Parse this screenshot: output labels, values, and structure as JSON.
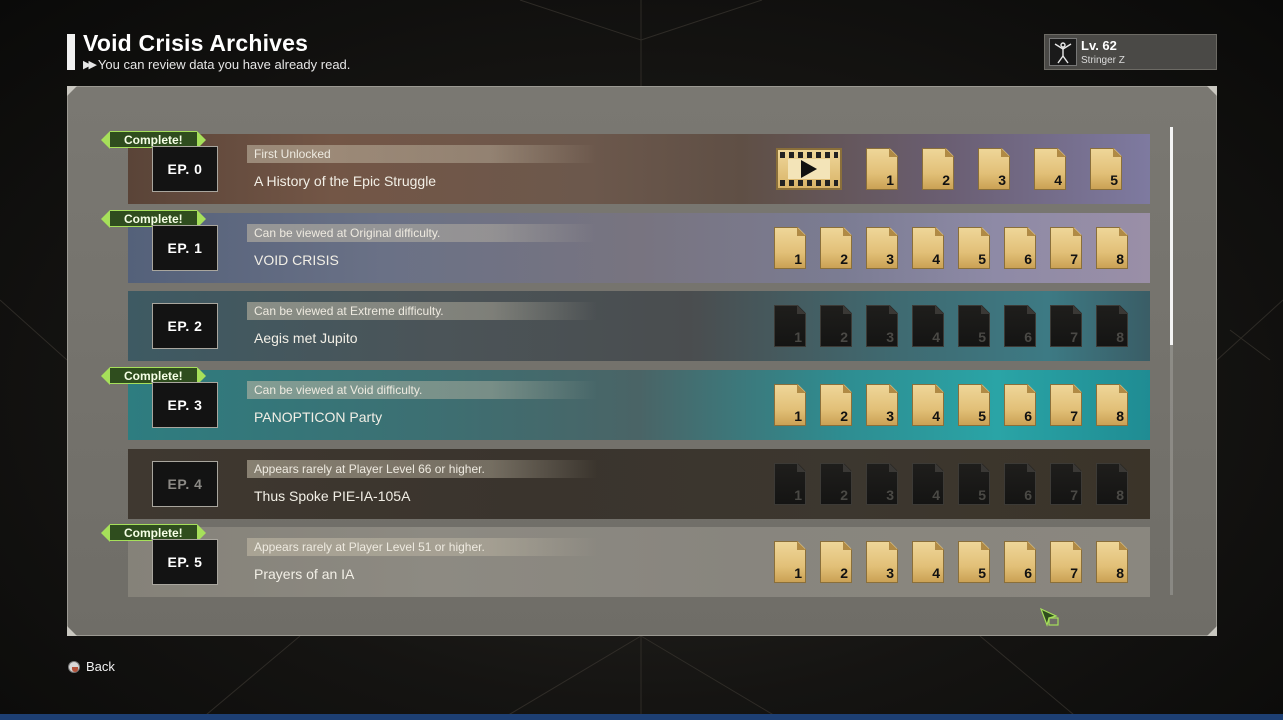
{
  "header": {
    "title": "Void Crisis Archives",
    "subtitle": "You can review data you have already read."
  },
  "player": {
    "level": "Lv. 62",
    "name": "Stringer Z"
  },
  "episodes": [
    {
      "label": "EP. 0",
      "complete": "Complete!",
      "requirement": "First Unlocked",
      "title": "A History of the Epic Struggle",
      "has_video": true,
      "files": [
        "1",
        "2",
        "3",
        "4",
        "5"
      ],
      "unlocked": true
    },
    {
      "label": "EP. 1",
      "complete": "Complete!",
      "requirement": "Can be viewed at Original difficulty.",
      "title": "VOID CRISIS",
      "files": [
        "1",
        "2",
        "3",
        "4",
        "5",
        "6",
        "7",
        "8"
      ],
      "unlocked": true
    },
    {
      "label": "EP. 2",
      "complete": "",
      "requirement": "Can be viewed at Extreme difficulty.",
      "title": "Aegis met Jupito",
      "files": [
        "1",
        "2",
        "3",
        "4",
        "5",
        "6",
        "7",
        "8"
      ],
      "unlocked": false
    },
    {
      "label": "EP. 3",
      "complete": "Complete!",
      "requirement": "Can be viewed at Void difficulty.",
      "title": "PANOPTICON Party",
      "files": [
        "1",
        "2",
        "3",
        "4",
        "5",
        "6",
        "7",
        "8"
      ],
      "unlocked": true
    },
    {
      "label": "EP. 4",
      "complete": "",
      "requirement": "Appears rarely at Player Level 66 or higher.",
      "title": "Thus Spoke PIE-IA-105A",
      "files": [
        "1",
        "2",
        "3",
        "4",
        "5",
        "6",
        "7",
        "8"
      ],
      "unlocked": false
    },
    {
      "label": "EP. 5",
      "complete": "Complete!",
      "requirement": "Appears rarely at Player Level 51 or higher.",
      "title": "Prayers of an IA",
      "files": [
        "1",
        "2",
        "3",
        "4",
        "5",
        "6",
        "7",
        "8"
      ],
      "unlocked": true
    }
  ],
  "footer": {
    "back_label": "Back"
  },
  "icons": {
    "video": "film-play-icon",
    "file": "document-icon",
    "cursor": "pointer-cursor-icon",
    "back": "back-button-glyph-icon"
  },
  "colors": {
    "complete_badge": "#a6e05a",
    "file_gold": "#e2c078",
    "bottom_strip": "#1d3f73"
  }
}
